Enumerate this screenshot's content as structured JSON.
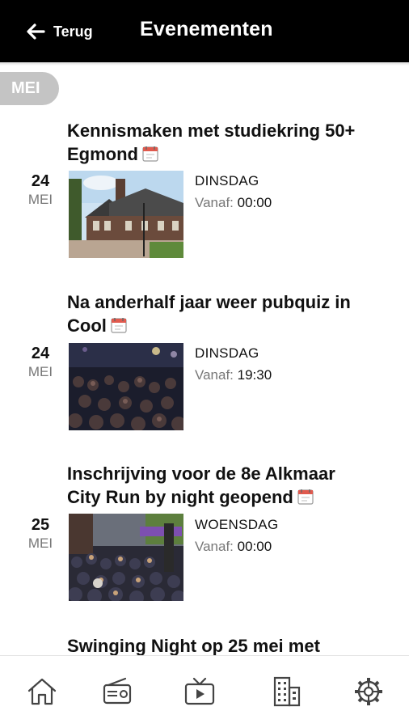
{
  "header": {
    "back_label": "Terug",
    "title": "Evenementen"
  },
  "month_pill": "MEI",
  "events": [
    {
      "title_line1": "Kennismaken met studiekring 50+",
      "title_line2": "Egmond",
      "day": "24",
      "month": "MEI",
      "weekday": "DINSDAG",
      "time_label": "Vanaf:",
      "time": "00:00",
      "image": "school-building-photo"
    },
    {
      "title_line1": "Na anderhalf jaar weer pubquiz in",
      "title_line2": "Cool",
      "day": "24",
      "month": "MEI",
      "weekday": "DINSDAG",
      "time_label": "Vanaf:",
      "time": "19:30",
      "image": "pub-crowd-photo"
    },
    {
      "title_line1": "Inschrijving voor de 8e Alkmaar",
      "title_line2": "City Run by night geopend",
      "day": "25",
      "month": "MEI",
      "weekday": "WOENSDAG",
      "time_label": "Vanaf:",
      "time": "00:00",
      "image": "run-start-crowd-photo"
    },
    {
      "title_line1": "Swinging Night op 25 mei met"
    }
  ],
  "bottom_nav": [
    {
      "icon": "home-icon"
    },
    {
      "icon": "radio-icon"
    },
    {
      "icon": "tv-icon"
    },
    {
      "icon": "buildings-icon"
    },
    {
      "icon": "settings-gear-icon"
    }
  ],
  "colors": {
    "header_bg": "#000000",
    "pill_bg": "#c4c4c4",
    "muted_text": "#777777"
  }
}
